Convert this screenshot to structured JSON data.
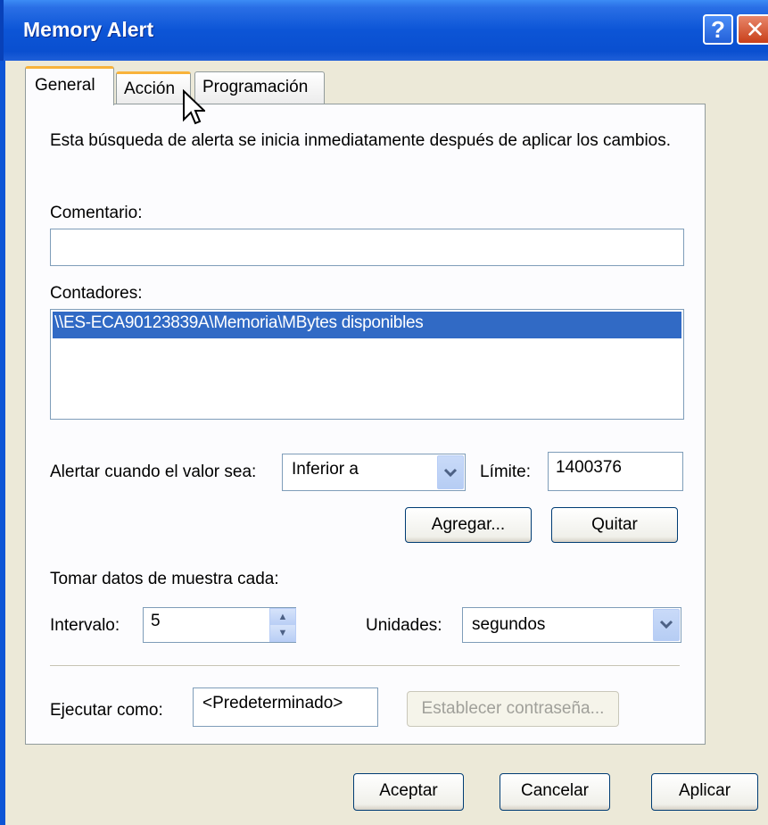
{
  "window": {
    "title": "Memory Alert",
    "help_label": "?",
    "close_label": "✕"
  },
  "tabs": [
    {
      "label": "General"
    },
    {
      "label": "Acción"
    },
    {
      "label": "Programación"
    }
  ],
  "general": {
    "description": "Esta búsqueda de alerta se inicia inmediatamente después de aplicar los cambios.",
    "comment_label": "Comentario:",
    "comment_value": "",
    "counters_label": "Contadores:",
    "counters": [
      "\\\\ES-ECA90123839A\\Memoria\\MBytes disponibles"
    ],
    "alert_when_label": "Alertar cuando el valor sea:",
    "alert_when_value": "Inferior a",
    "limit_label": "Límite:",
    "limit_value": "1400376",
    "add_button": "Agregar...",
    "remove_button": "Quitar",
    "sample_label": "Tomar datos de muestra cada:",
    "interval_label": "Intervalo:",
    "interval_value": "5",
    "units_label": "Unidades:",
    "units_value": "segundos",
    "run_as_label": "Ejecutar como:",
    "run_as_value": "<Predeterminado>",
    "set_password_button": "Establecer contraseña..."
  },
  "footer": {
    "ok_button": "Aceptar",
    "cancel_button": "Cancelar",
    "apply_button": "Aplicar"
  },
  "colors": {
    "titlebar": "#0c55d6",
    "selection": "#316ac5",
    "dialog_bg": "#ece9d8",
    "tab_accent": "#f8b33a"
  }
}
